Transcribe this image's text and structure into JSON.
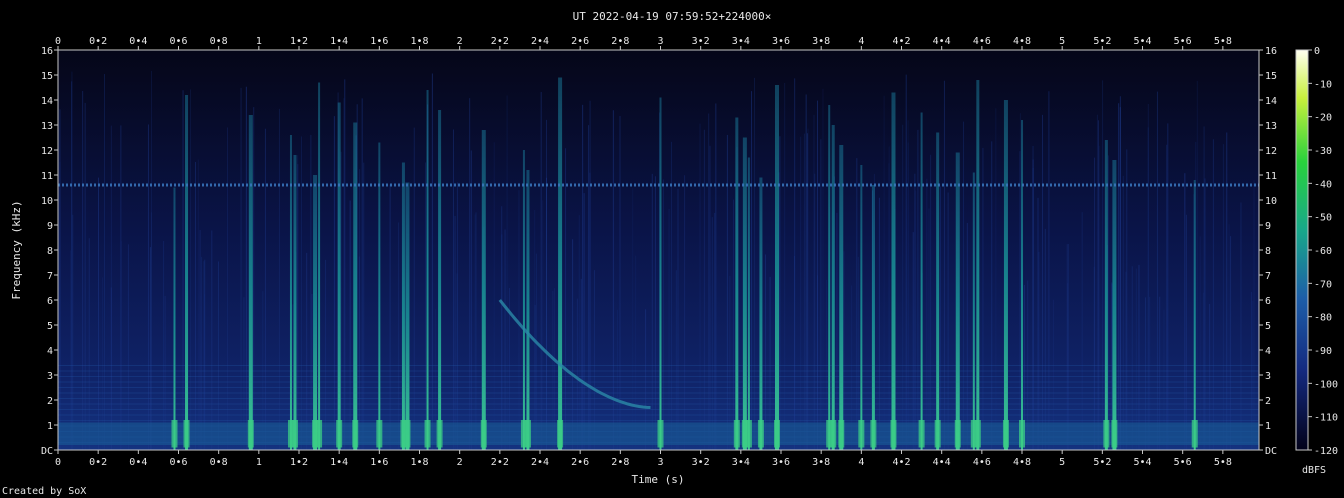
{
  "chart_data": {
    "type": "heatmap",
    "title": "UT 2022-04-19 07:59:52+224000×",
    "xlabel": "Time (s)",
    "ylabel": "Frequency (kHz)",
    "xlim": [
      0,
      5.98
    ],
    "ylim": [
      0,
      16
    ],
    "x_ticks": [
      "0",
      "0•2",
      "0•4",
      "0•6",
      "0•8",
      "1",
      "1•2",
      "1•4",
      "1•6",
      "1•8",
      "2",
      "2•2",
      "2•4",
      "2•6",
      "2•8",
      "3",
      "3•2",
      "3•4",
      "3•6",
      "3•8",
      "4",
      "4•2",
      "4•4",
      "4•6",
      "4•8",
      "5",
      "5•2",
      "5•4",
      "5•6",
      "5•8"
    ],
    "y_ticks": [
      "DC",
      "1",
      "2",
      "3",
      "4",
      "5",
      "6",
      "7",
      "8",
      "9",
      "10",
      "11",
      "12",
      "13",
      "14",
      "15",
      "16"
    ],
    "colorbar": {
      "label": "dBFS",
      "range": [
        -120,
        0
      ],
      "ticks": [
        "0",
        "-10",
        "-20",
        "-30",
        "-40",
        "-50",
        "-60",
        "-70",
        "-80",
        "-90",
        "-100",
        "-110",
        "-120"
      ]
    },
    "features": {
      "carrier_khz": 10.6,
      "chirp": {
        "t_start_s": 2.2,
        "f_start_khz": 6.0,
        "t_end_s": 2.95,
        "f_end_khz": 1.7
      },
      "transients_s": [
        0.58,
        0.64,
        0.96,
        1.16,
        1.18,
        1.28,
        1.3,
        1.4,
        1.48,
        1.6,
        1.72,
        1.74,
        1.84,
        1.9,
        2.12,
        2.32,
        2.34,
        2.5,
        3.0,
        3.38,
        3.42,
        3.44,
        3.5,
        3.58,
        3.84,
        3.86,
        3.9,
        4.0,
        4.06,
        4.16,
        4.3,
        4.38,
        4.48,
        4.56,
        4.58,
        4.72,
        4.8,
        5.22,
        5.26,
        5.66
      ]
    }
  },
  "credit": "Created by SoX",
  "colors": {
    "background": "#000000",
    "axis": "#c8c8c8",
    "text": "#e8e8e8"
  }
}
